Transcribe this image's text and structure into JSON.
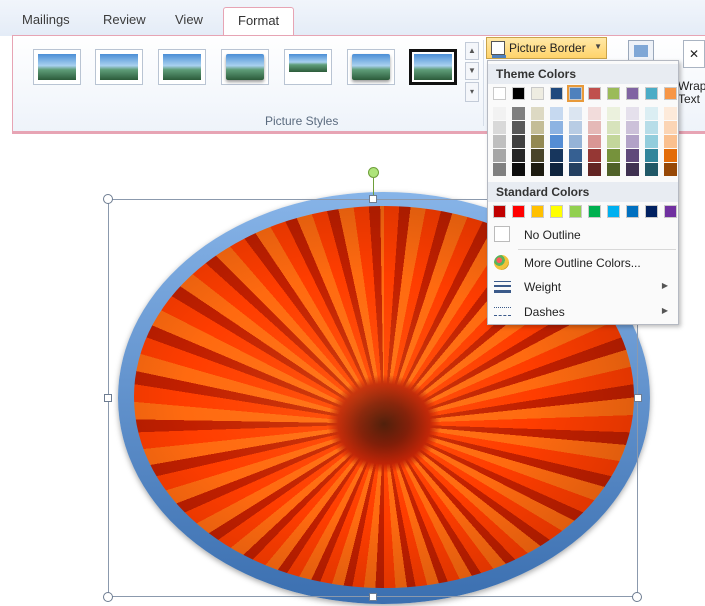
{
  "tabs": [
    {
      "label": "Mailings"
    },
    {
      "label": "Review"
    },
    {
      "label": "View"
    },
    {
      "label": "Format",
      "active": true
    }
  ],
  "picture_styles": {
    "group_label": "Picture Styles",
    "selected_index": 6
  },
  "picture_border_button": {
    "label": "Picture Border"
  },
  "wrap_text": {
    "line1": "Wrap",
    "line2": "Text"
  },
  "dropdown": {
    "theme_heading": "Theme Colors",
    "standard_heading": "Standard Colors",
    "theme_colors": [
      "#ffffff",
      "#000000",
      "#eeece1",
      "#1f497d",
      "#4f81bd",
      "#c0504d",
      "#9bbb59",
      "#8064a2",
      "#4bacc6",
      "#f79646"
    ],
    "theme_shades": [
      [
        "#f2f2f2",
        "#d9d9d9",
        "#bfbfbf",
        "#a6a6a6",
        "#808080"
      ],
      [
        "#7f7f7f",
        "#595959",
        "#404040",
        "#262626",
        "#0d0d0d"
      ],
      [
        "#ddd9c3",
        "#c4bd97",
        "#938953",
        "#494429",
        "#1d1b10"
      ],
      [
        "#c6d9f0",
        "#8db3e2",
        "#548dd4",
        "#17365d",
        "#0f243e"
      ],
      [
        "#dbe5f1",
        "#b8cce4",
        "#95b3d7",
        "#366092",
        "#244061"
      ],
      [
        "#f2dcdb",
        "#e5b9b7",
        "#d99694",
        "#953734",
        "#632423"
      ],
      [
        "#ebf1dd",
        "#d7e3bc",
        "#c3d69b",
        "#76923c",
        "#4f6128"
      ],
      [
        "#e5e0ec",
        "#ccc1d9",
        "#b2a2c7",
        "#5f497a",
        "#3f3151"
      ],
      [
        "#dbeef3",
        "#b7dde8",
        "#92cddc",
        "#31859b",
        "#205867"
      ],
      [
        "#fdeada",
        "#fbd5b5",
        "#fac08f",
        "#e36c09",
        "#974806"
      ]
    ],
    "selected_theme_index": 4,
    "standard_colors": [
      "#c00000",
      "#ff0000",
      "#ffc000",
      "#ffff00",
      "#92d050",
      "#00b050",
      "#00b0f0",
      "#0070c0",
      "#002060",
      "#7030a0"
    ],
    "no_outline": "No Outline",
    "more_colors": "More Outline Colors...",
    "weight": "Weight",
    "dashes": "Dashes"
  }
}
